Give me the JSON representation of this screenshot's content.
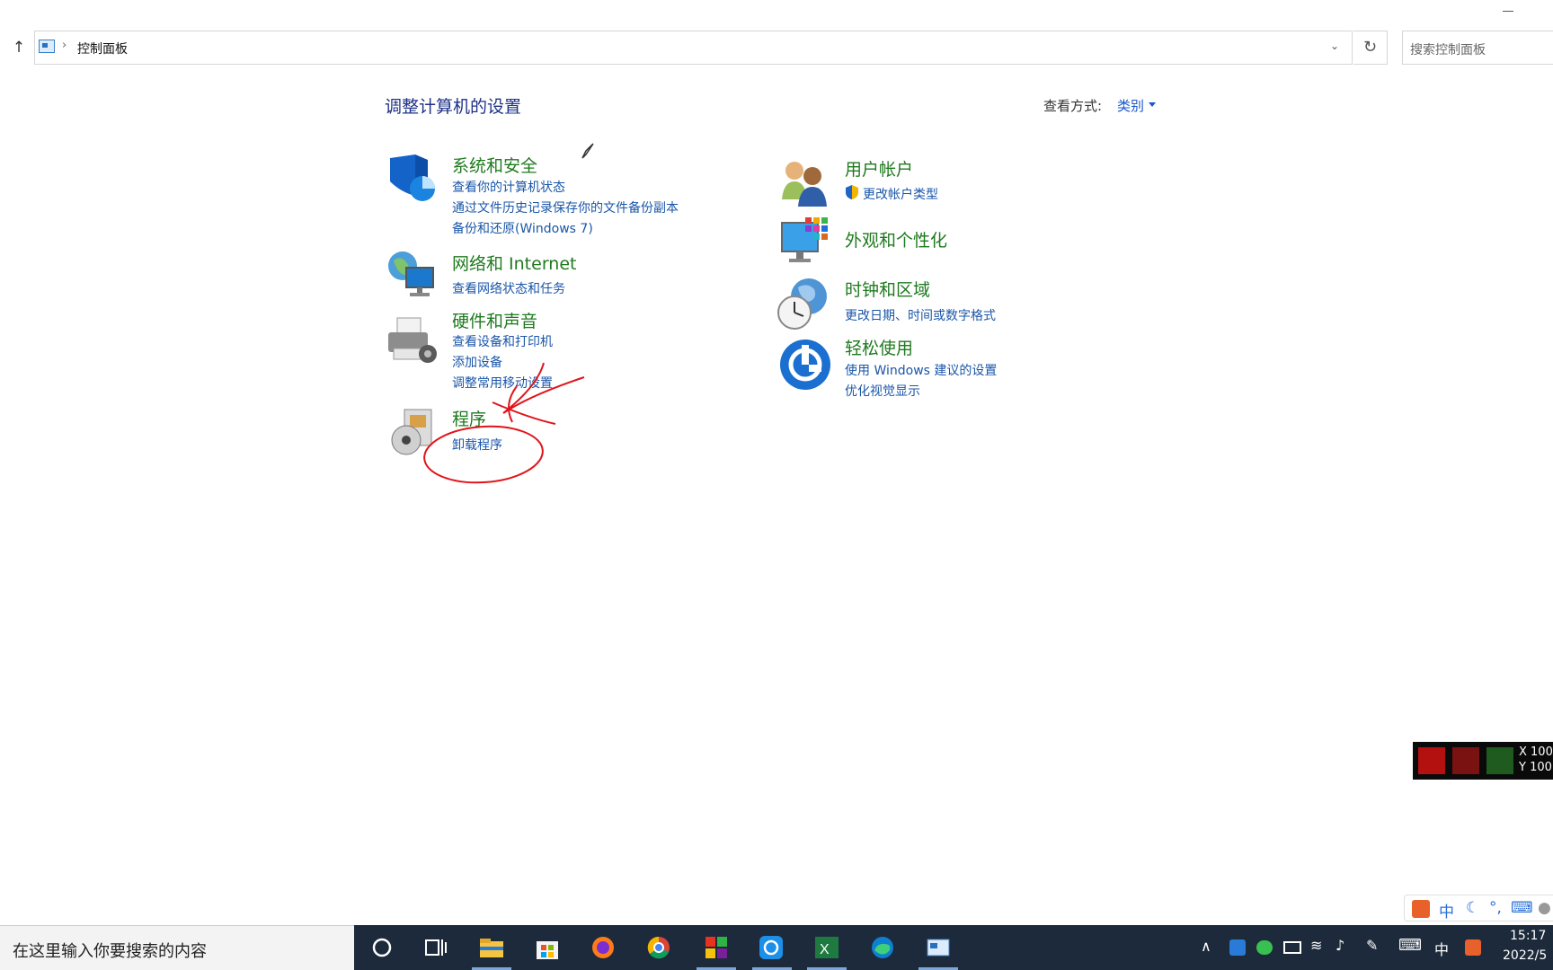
{
  "address": {
    "path": "控制面板",
    "search_placeholder": "搜索控制面板"
  },
  "header": {
    "title": "调整计算机的设置",
    "view_label": "查看方式:",
    "view_value": "类别"
  },
  "categories": {
    "system": {
      "title": "系统和安全",
      "links": [
        "查看你的计算机状态",
        "通过文件历史记录保存你的文件备份副本",
        "备份和还原(Windows 7)"
      ]
    },
    "network": {
      "title": "网络和 Internet",
      "links": [
        "查看网络状态和任务"
      ]
    },
    "hardware": {
      "title": "硬件和声音",
      "links": [
        "查看设备和打印机",
        "添加设备",
        "调整常用移动设置"
      ]
    },
    "programs": {
      "title": "程序",
      "links": [
        "卸载程序"
      ]
    },
    "users": {
      "title": "用户帐户",
      "links": [
        "更改帐户类型"
      ]
    },
    "appearance": {
      "title": "外观和个性化",
      "links": []
    },
    "clock": {
      "title": "时钟和区域",
      "links": [
        "更改日期、时间或数字格式"
      ]
    },
    "ease": {
      "title": "轻松使用",
      "links": [
        "使用 Windows 建议的设置",
        "优化视觉显示"
      ]
    }
  },
  "mouse_overlay": {
    "x_label": "X 100",
    "y_label": "Y 100"
  },
  "taskbar": {
    "search_placeholder": "在这里输入你要搜索的内容",
    "ime_indicator": "中",
    "time": "15:17",
    "date": "2022/5",
    "icons": [
      "cortana-icon",
      "task-view-icon",
      "file-explorer-icon",
      "store-icon",
      "firefox-icon",
      "chrome-icon",
      "app-icon",
      "browser-icon",
      "excel-icon",
      "edge-icon",
      "control-panel-icon"
    ]
  },
  "ime_bar": {
    "label": "中"
  },
  "colors": {
    "title_green": "#1f7a1f",
    "link_blue": "#1a56a8",
    "heading_blue": "#1e3287",
    "taskbar": "#1c2a3b",
    "ink": "#e0141a"
  }
}
